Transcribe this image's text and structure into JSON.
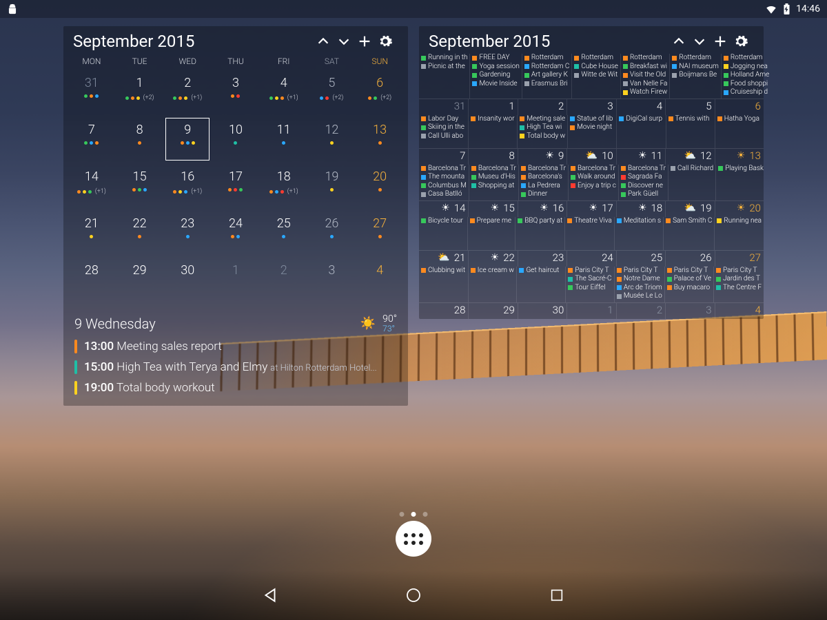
{
  "status": {
    "time": "14:46"
  },
  "palette": {
    "green": "#37c85b",
    "blue": "#2aa8ff",
    "orange": "#ff8a1f",
    "red": "#ff3b30",
    "yellow": "#ffd21f",
    "teal": "#1fbfa6",
    "purple": "#7d5bd9",
    "grey": "#9aa1ad"
  },
  "left": {
    "title": "September 2015",
    "dow": [
      "MON",
      "TUE",
      "WED",
      "THU",
      "FRI",
      "SAT",
      "SUN"
    ],
    "rows": [
      [
        {
          "n": "31",
          "dim": true,
          "dots": [
            "green",
            "orange",
            "blue"
          ]
        },
        {
          "n": "1",
          "dots": [
            "green",
            "orange",
            "yellow"
          ],
          "extra": "(+2)"
        },
        {
          "n": "2",
          "dots": [
            "green",
            "orange",
            "yellow"
          ],
          "extra": "(+1)"
        },
        {
          "n": "3",
          "dots": [
            "orange",
            "red"
          ]
        },
        {
          "n": "4",
          "dots": [
            "green",
            "yellow",
            "orange"
          ],
          "extra": "(+1)"
        },
        {
          "n": "5",
          "sat": true,
          "dots": [
            "blue",
            "red"
          ],
          "extra": "(+2)"
        },
        {
          "n": "6",
          "sun": true,
          "dots": [
            "orange",
            "green"
          ],
          "extra": "(+2)"
        }
      ],
      [
        {
          "n": "7",
          "dots": [
            "green",
            "blue",
            "orange"
          ]
        },
        {
          "n": "8",
          "dots": [
            "orange"
          ]
        },
        {
          "n": "9",
          "today": true,
          "dots": [
            "orange",
            "blue",
            "yellow"
          ]
        },
        {
          "n": "10",
          "dots": [
            "teal"
          ]
        },
        {
          "n": "11",
          "dots": [
            "blue"
          ]
        },
        {
          "n": "12",
          "sat": true,
          "dots": [
            "yellow"
          ]
        },
        {
          "n": "13",
          "sun": true,
          "dots": [
            "orange"
          ]
        }
      ],
      [
        {
          "n": "14",
          "dots": [
            "orange",
            "yellow",
            "green"
          ],
          "extra": "(+1)"
        },
        {
          "n": "15",
          "dots": [
            "orange",
            "green",
            "blue"
          ]
        },
        {
          "n": "16",
          "dots": [
            "orange",
            "yellow",
            "blue"
          ],
          "extra": "(+1)"
        },
        {
          "n": "17",
          "dots": [
            "orange",
            "red",
            "green"
          ]
        },
        {
          "n": "18",
          "dots": [
            "orange",
            "blue",
            "red"
          ],
          "extra": "(+1)"
        },
        {
          "n": "19",
          "sat": true,
          "dots": [
            "yellow"
          ]
        },
        {
          "n": "20",
          "sun": true,
          "dots": [
            "orange"
          ]
        }
      ],
      [
        {
          "n": "21",
          "dots": [
            "yellow"
          ]
        },
        {
          "n": "22",
          "dots": [
            "orange"
          ]
        },
        {
          "n": "23",
          "dots": [
            "blue"
          ]
        },
        {
          "n": "24",
          "dots": [
            "orange",
            "blue"
          ]
        },
        {
          "n": "25",
          "dots": [
            "blue"
          ]
        },
        {
          "n": "26",
          "sat": true,
          "dots": [
            "blue"
          ]
        },
        {
          "n": "27",
          "sun": true,
          "dots": [
            "orange"
          ]
        }
      ],
      [
        {
          "n": "28"
        },
        {
          "n": "29"
        },
        {
          "n": "30"
        },
        {
          "n": "1",
          "dim": true
        },
        {
          "n": "2",
          "dim": true
        },
        {
          "n": "3",
          "dim": true,
          "sat": true
        },
        {
          "n": "4",
          "dim": true,
          "sun": true
        }
      ]
    ],
    "agenda": {
      "day": "9 Wednesday",
      "temp_hi": "90°",
      "temp_lo": "73°",
      "items": [
        {
          "color": "orange",
          "time": "13:00",
          "title": "Meeting sales report"
        },
        {
          "color": "teal",
          "time": "15:00",
          "title": "High Tea with Terya and Elmy",
          "loc": "at Hilton Rotterdam Hotel..."
        },
        {
          "color": "yellow",
          "time": "19:00",
          "title": "Total body workout"
        }
      ]
    }
  },
  "right": {
    "title": "September 2015",
    "rows": [
      {
        "events": [
          [
            [
              "green",
              "Running in th"
            ],
            [
              "grey",
              "Picnic at the"
            ]
          ],
          [
            [
              "orange",
              "FREE DAY"
            ],
            [
              "green",
              "Yoga session"
            ],
            [
              "green",
              "Gardening"
            ],
            [
              "blue",
              "Movie Inside"
            ]
          ],
          [
            [
              "orange",
              "Rotterdam"
            ],
            [
              "blue",
              "Rotterdam C"
            ],
            [
              "green",
              "Art gallery K"
            ],
            [
              "grey",
              "Erasmus Bri"
            ]
          ],
          [
            [
              "orange",
              "Rotterdam"
            ],
            [
              "teal",
              "Cube House"
            ],
            [
              "grey",
              "Witte de Wit"
            ]
          ],
          [
            [
              "orange",
              "Rotterdam"
            ],
            [
              "green",
              "Breakfast wi"
            ],
            [
              "orange",
              "Visit the Old"
            ],
            [
              "grey",
              "Van Nelle Fa"
            ],
            [
              "yellow",
              "Watch Firew"
            ]
          ],
          [
            [
              "orange",
              "Rotterdam"
            ],
            [
              "blue",
              "NAI museum"
            ],
            [
              "grey",
              "Boijmans Be"
            ]
          ],
          [
            [
              "orange",
              "Rotterdam"
            ],
            [
              "yellow",
              "Jogging nea"
            ],
            [
              "green",
              "Holland Ame"
            ],
            [
              "green",
              "Food shoppi"
            ],
            [
              "blue",
              "Cruiseship d"
            ]
          ]
        ],
        "dates": [
          {
            "n": "31",
            "dim": true
          },
          {
            "n": "1"
          },
          {
            "n": "2"
          },
          {
            "n": "3"
          },
          {
            "n": "4"
          },
          {
            "n": "5"
          },
          {
            "n": "6",
            "sun": true
          }
        ]
      },
      {
        "events": [
          [
            [
              "orange",
              "Labor Day"
            ],
            [
              "green",
              "Skiing in the"
            ],
            [
              "grey",
              "Call Ulli abo"
            ]
          ],
          [
            [
              "orange",
              "Insanity wor"
            ]
          ],
          [
            [
              "orange",
              "Meeting sale"
            ],
            [
              "teal",
              "High Tea wi"
            ],
            [
              "yellow",
              "Total body w"
            ]
          ],
          [
            [
              "blue",
              "Statue of lib"
            ],
            [
              "orange",
              "Movie night"
            ]
          ],
          [
            [
              "blue",
              "DigiCal surp"
            ]
          ],
          [
            [
              "orange",
              "Tennis with"
            ]
          ],
          [
            [
              "orange",
              "Hatha Yoga"
            ]
          ]
        ],
        "dates": [
          {
            "n": "7"
          },
          {
            "n": "8"
          },
          {
            "n": "9",
            "w": "☀"
          },
          {
            "n": "10",
            "w": "⛅"
          },
          {
            "n": "11",
            "w": "☀"
          },
          {
            "n": "12",
            "w": "⛅"
          },
          {
            "n": "13",
            "w": "☀",
            "sun": true
          }
        ]
      },
      {
        "events": [
          [
            [
              "orange",
              "Barcelona Tr"
            ],
            [
              "blue",
              "The mounta"
            ],
            [
              "green",
              "Columbus M"
            ],
            [
              "grey",
              "Casa Batlló"
            ]
          ],
          [
            [
              "orange",
              "Barcelona Tr"
            ],
            [
              "green",
              "Museu d'His"
            ],
            [
              "teal",
              "Shopping at"
            ]
          ],
          [
            [
              "orange",
              "Barcelona Tr"
            ],
            [
              "orange",
              "Barcelona's"
            ],
            [
              "blue",
              "La Pedrera"
            ],
            [
              "green",
              "Dinner"
            ]
          ],
          [
            [
              "orange",
              "Barcelona Tr"
            ],
            [
              "green",
              "Walk around"
            ],
            [
              "red",
              "Enjoy a trip c"
            ]
          ],
          [
            [
              "orange",
              "Barcelona Tr"
            ],
            [
              "red",
              "Sagrada Fa"
            ],
            [
              "green",
              "Discover ne"
            ],
            [
              "green",
              "Park Güell"
            ]
          ],
          [
            [
              "grey",
              "Call Richard"
            ]
          ],
          [
            [
              "green",
              "Playing Bask"
            ]
          ]
        ],
        "dates": [
          {
            "n": "14",
            "w": "☀"
          },
          {
            "n": "15",
            "w": "☀"
          },
          {
            "n": "16",
            "w": "☀"
          },
          {
            "n": "17",
            "w": "☀"
          },
          {
            "n": "18",
            "w": "☀"
          },
          {
            "n": "19",
            "w": "⛅"
          },
          {
            "n": "20",
            "w": "☀",
            "sun": true
          }
        ]
      },
      {
        "events": [
          [
            [
              "green",
              "Bicycle tour"
            ]
          ],
          [
            [
              "orange",
              "Prepare me"
            ]
          ],
          [
            [
              "green",
              "BBQ party at"
            ]
          ],
          [
            [
              "orange",
              "Theatre Viva"
            ]
          ],
          [
            [
              "blue",
              "Meditation s"
            ]
          ],
          [
            [
              "orange",
              "Sam Smith C"
            ]
          ],
          [
            [
              "yellow",
              "Running nea"
            ]
          ]
        ],
        "dates": [
          {
            "n": "21",
            "w": "⛅"
          },
          {
            "n": "22",
            "w": "☀"
          },
          {
            "n": "23"
          },
          {
            "n": "24"
          },
          {
            "n": "25"
          },
          {
            "n": "26"
          },
          {
            "n": "27",
            "sun": true
          }
        ]
      },
      {
        "events": [
          [
            [
              "orange",
              "Clubbing wit"
            ]
          ],
          [
            [
              "orange",
              "Ice cream w"
            ]
          ],
          [
            [
              "blue",
              "Get haircut"
            ]
          ],
          [
            [
              "orange",
              "Paris City T"
            ],
            [
              "teal",
              "The Sacré-C"
            ],
            [
              "green",
              "Tour Eiffel"
            ]
          ],
          [
            [
              "orange",
              "Paris City T"
            ],
            [
              "orange",
              "Notre Dame"
            ],
            [
              "blue",
              "Arc de Triom"
            ],
            [
              "grey",
              "Musée Le Lo"
            ]
          ],
          [
            [
              "orange",
              "Paris City T"
            ],
            [
              "green",
              "Palace of Ve"
            ],
            [
              "orange",
              "Buy macaro"
            ]
          ],
          [
            [
              "orange",
              "Paris City T"
            ],
            [
              "green",
              "Jardin des T"
            ],
            [
              "teal",
              "The Centre F"
            ]
          ]
        ],
        "dates": [
          {
            "n": "28"
          },
          {
            "n": "29"
          },
          {
            "n": "30"
          },
          {
            "n": "1",
            "dim": true
          },
          {
            "n": "2",
            "dim": true
          },
          {
            "n": "3",
            "dim": true
          },
          {
            "n": "4",
            "dim": true,
            "sun": true
          }
        ]
      }
    ]
  }
}
